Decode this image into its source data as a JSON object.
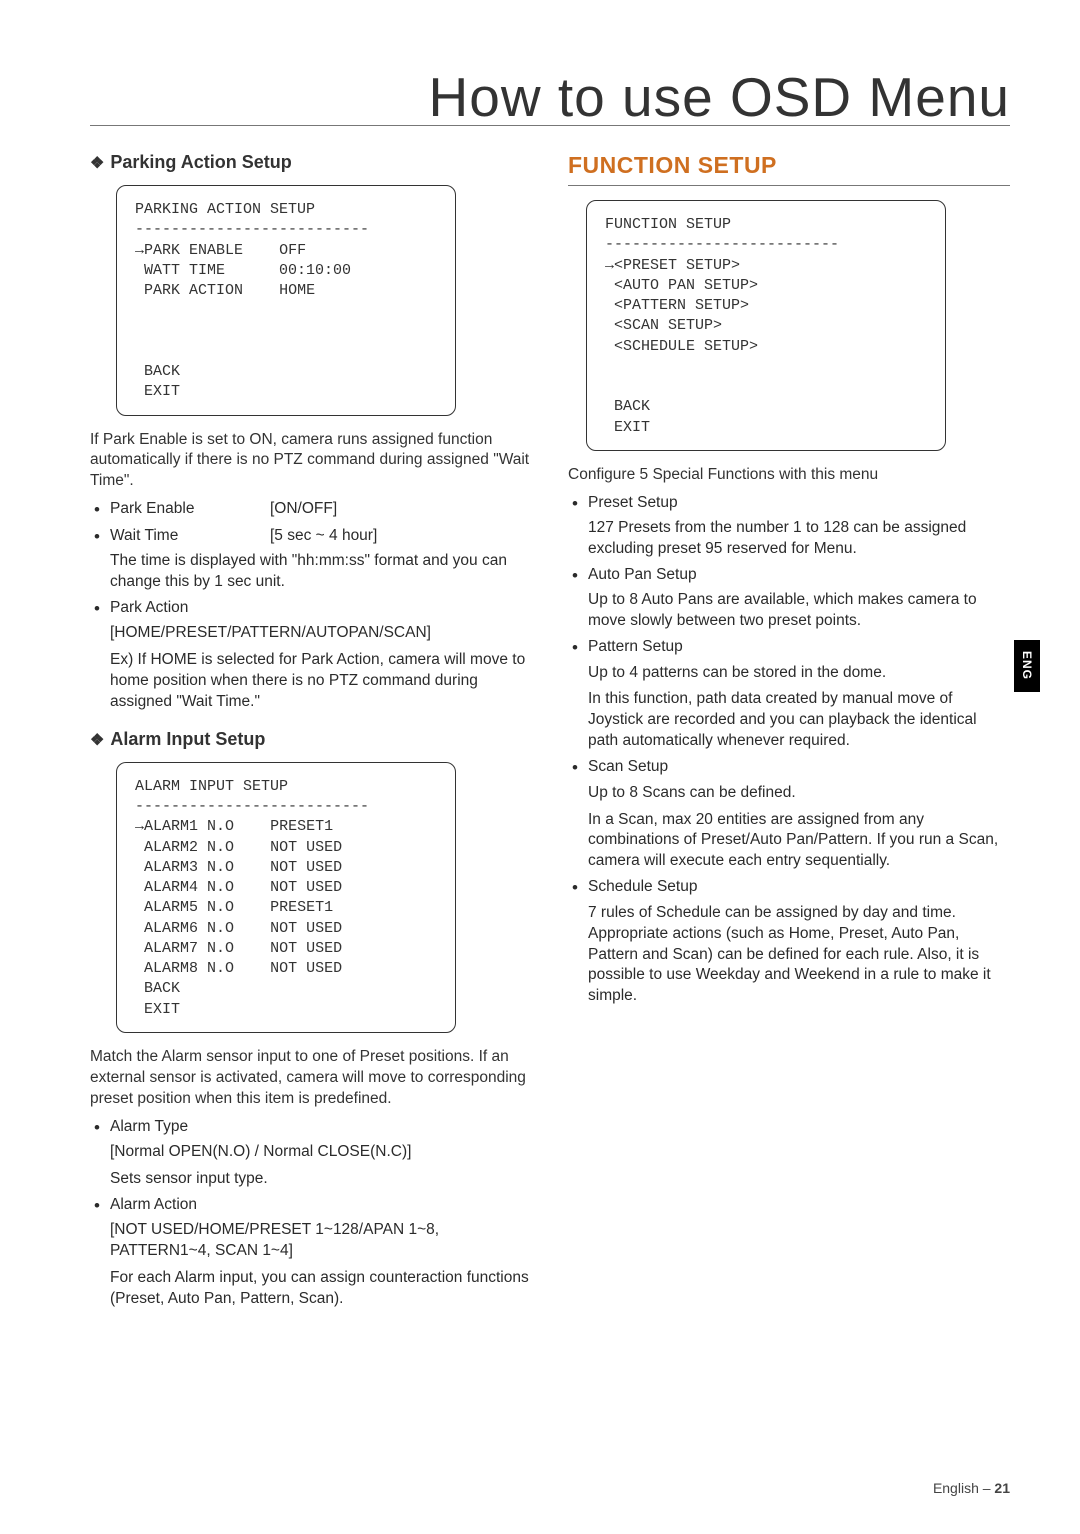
{
  "page_title": "How to use OSD Menu",
  "lang_tab": "ENG",
  "page_footer_label": "English –",
  "page_number": "21",
  "left": {
    "parking": {
      "heading": "Parking Action Setup",
      "osd_title": "PARKING ACTION SETUP",
      "osd_sep": "--------------------------",
      "row1_label": "PARK ENABLE",
      "row1_val": "OFF",
      "row2_label": "WATT TIME",
      "row2_val": "00:10:00",
      "row3_label": "PARK ACTION",
      "row3_val": "HOME",
      "back": "BACK",
      "exit": "EXIT",
      "intro": "If Park Enable is set to ON, camera runs assigned function automatically if there is no PTZ command during assigned \"Wait Time\".",
      "items": {
        "pe_label": "Park Enable",
        "pe_val": "[ON/OFF]",
        "wt_label": "Wait Time",
        "wt_val": "[5 sec ~ 4 hour]",
        "wt_desc": "The time is displayed with \"hh:mm:ss\" format and you can change this by 1 sec unit.",
        "pa_label": "Park Action",
        "pa_opts": "[HOME/PRESET/PATTERN/AUTOPAN/SCAN]",
        "pa_desc": "Ex) If HOME is selected for Park Action, camera will move to home position when there is no PTZ command during assigned \"Wait Time.\""
      }
    },
    "alarm": {
      "heading": "Alarm Input Setup",
      "osd_title": "ALARM INPUT SETUP",
      "osd_sep": "--------------------------",
      "rows": [
        {
          "n": "ALARM1",
          "t": "N.O",
          "a": "PRESET1"
        },
        {
          "n": "ALARM2",
          "t": "N.O",
          "a": "NOT USED"
        },
        {
          "n": "ALARM3",
          "t": "N.O",
          "a": "NOT USED"
        },
        {
          "n": "ALARM4",
          "t": "N.O",
          "a": "NOT USED"
        },
        {
          "n": "ALARM5",
          "t": "N.O",
          "a": "PRESET1"
        },
        {
          "n": "ALARM6",
          "t": "N.O",
          "a": "NOT USED"
        },
        {
          "n": "ALARM7",
          "t": "N.O",
          "a": "NOT USED"
        },
        {
          "n": "ALARM8",
          "t": "N.O",
          "a": "NOT USED"
        }
      ],
      "back": "BACK",
      "exit": "EXIT",
      "intro": "Match the Alarm sensor input to one of Preset positions. If an external sensor is activated, camera will move to corresponding preset position when this item is predefined.",
      "at_label": "Alarm Type",
      "at_opts": "[Normal OPEN(N.O) / Normal CLOSE(N.C)]",
      "at_desc": "Sets sensor input type.",
      "aa_label": "Alarm Action",
      "aa_opts": "[NOT USED/HOME/PRESET 1~128/APAN 1~8, PATTERN1~4, SCAN 1~4]",
      "aa_desc": "For each Alarm input, you can assign counteraction functions (Preset, Auto Pan, Pattern, Scan)."
    }
  },
  "right": {
    "heading": "FUNCTION SETUP",
    "osd_title": "FUNCTION SETUP",
    "osd_sep": "--------------------------",
    "osd_items": [
      "<PRESET SETUP>",
      "<AUTO PAN SETUP>",
      "<PATTERN SETUP>",
      "<SCAN SETUP>",
      "<SCHEDULE SETUP>"
    ],
    "back": "BACK",
    "exit": "EXIT",
    "intro": "Configure 5 Special Functions with this menu",
    "items": [
      {
        "label": "Preset Setup",
        "desc": "127 Presets from the number 1 to 128 can be assigned excluding preset 95 reserved for Menu."
      },
      {
        "label": "Auto Pan Setup",
        "desc": "Up to 8 Auto Pans are available, which makes camera to move slowly between two preset points."
      },
      {
        "label": "Pattern Setup",
        "desc": "Up to 4 patterns can be stored in the dome.",
        "desc2": "In this function, path data created by manual move of Joystick are recorded and you can playback the identical path automatically whenever required."
      },
      {
        "label": "Scan Setup",
        "desc": "Up to 8 Scans can be defined.",
        "desc2": "In a Scan, max 20 entities are assigned from any combinations of Preset/Auto Pan/Pattern. If you run a Scan, camera will execute each entry sequentially."
      },
      {
        "label": "Schedule Setup",
        "desc": "7 rules of Schedule can be assigned by day and time. Appropriate actions (such as Home, Preset, Auto Pan, Pattern and Scan) can be defined for each rule. Also, it is possible to use Weekday and Weekend in a rule to make it simple."
      }
    ]
  }
}
